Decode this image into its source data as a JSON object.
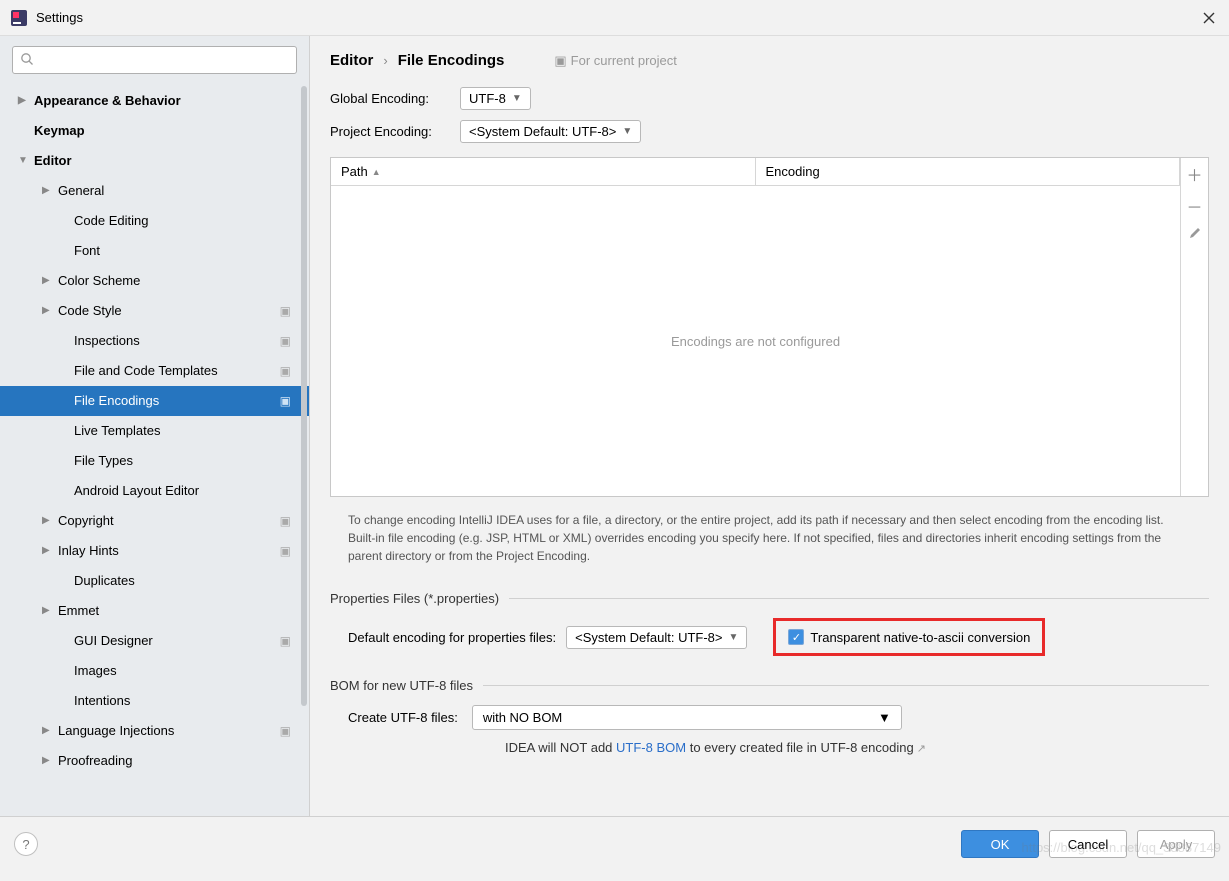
{
  "window": {
    "title": "Settings"
  },
  "search": {
    "placeholder": ""
  },
  "sidebar": {
    "items": [
      {
        "label": "Appearance & Behavior",
        "level": 0,
        "arrow": "collapsed",
        "bold": true
      },
      {
        "label": "Keymap",
        "level": 0,
        "arrow": "none",
        "bold": true
      },
      {
        "label": "Editor",
        "level": 0,
        "arrow": "expanded",
        "bold": true
      },
      {
        "label": "General",
        "level": 1,
        "arrow": "collapsed"
      },
      {
        "label": "Code Editing",
        "level": 2,
        "arrow": "none"
      },
      {
        "label": "Font",
        "level": 2,
        "arrow": "none"
      },
      {
        "label": "Color Scheme",
        "level": 1,
        "arrow": "collapsed"
      },
      {
        "label": "Code Style",
        "level": 1,
        "arrow": "collapsed",
        "proj": true
      },
      {
        "label": "Inspections",
        "level": 2,
        "arrow": "none",
        "proj": true
      },
      {
        "label": "File and Code Templates",
        "level": 2,
        "arrow": "none",
        "proj": true
      },
      {
        "label": "File Encodings",
        "level": 2,
        "arrow": "none",
        "proj": true,
        "selected": true
      },
      {
        "label": "Live Templates",
        "level": 2,
        "arrow": "none"
      },
      {
        "label": "File Types",
        "level": 2,
        "arrow": "none"
      },
      {
        "label": "Android Layout Editor",
        "level": 2,
        "arrow": "none"
      },
      {
        "label": "Copyright",
        "level": 1,
        "arrow": "collapsed",
        "proj": true
      },
      {
        "label": "Inlay Hints",
        "level": 1,
        "arrow": "collapsed",
        "proj": true
      },
      {
        "label": "Duplicates",
        "level": 2,
        "arrow": "none"
      },
      {
        "label": "Emmet",
        "level": 1,
        "arrow": "collapsed"
      },
      {
        "label": "GUI Designer",
        "level": 2,
        "arrow": "none",
        "proj": true
      },
      {
        "label": "Images",
        "level": 2,
        "arrow": "none"
      },
      {
        "label": "Intentions",
        "level": 2,
        "arrow": "none"
      },
      {
        "label": "Language Injections",
        "level": 1,
        "arrow": "collapsed",
        "proj": true
      },
      {
        "label": "Proofreading",
        "level": 1,
        "arrow": "collapsed"
      }
    ]
  },
  "breadcrumb": {
    "root": "Editor",
    "leaf": "File Encodings",
    "note": "For current project"
  },
  "global_encoding": {
    "label": "Global Encoding:",
    "value": "UTF-8"
  },
  "project_encoding": {
    "label": "Project Encoding:",
    "value": "<System Default: UTF-8>"
  },
  "table": {
    "col_path": "Path",
    "col_enc": "Encoding",
    "empty": "Encodings are not configured"
  },
  "help_text": "To change encoding IntelliJ IDEA uses for a file, a directory, or the entire project, add its path if necessary and then select encoding from the encoding list. Built-in file encoding (e.g. JSP, HTML or XML) overrides encoding you specify here. If not specified, files and directories inherit encoding settings from the parent directory or from the Project Encoding.",
  "properties": {
    "section": "Properties Files (*.properties)",
    "label": "Default encoding for properties files:",
    "value": "<System Default: UTF-8>",
    "checkbox": "Transparent native-to-ascii conversion"
  },
  "bom": {
    "section": "BOM for new UTF-8 files",
    "label": "Create UTF-8 files:",
    "value": "with NO BOM",
    "note_pre": "IDEA will NOT add ",
    "note_link": "UTF-8 BOM",
    "note_post": " to every created file in UTF-8 encoding"
  },
  "buttons": {
    "ok": "OK",
    "cancel": "Cancel",
    "apply": "Apply"
  },
  "watermark": "https://blog.csdn.net/qq_38887149"
}
